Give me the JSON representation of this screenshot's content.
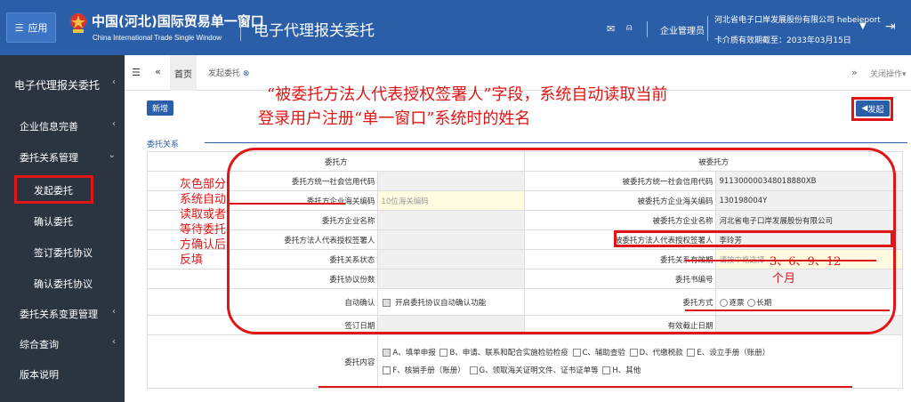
{
  "header": {
    "app_label": "应用",
    "logo_cn": "中国(河北)国际贸易单一窗口",
    "logo_en": "China International Trade Single Window",
    "system_name": "电子代理报关委托",
    "admin_label": "企业管理员",
    "company": "河北省电子口岸发展股份有限公司 hebeieport",
    "expiry": "卡介质有效期截至：2033年03月15日"
  },
  "sidebar": {
    "title": "电子代理报关委托",
    "items": [
      "企业信息完善",
      "委托关系管理",
      "发起委托",
      "确认委托",
      "签订委托协议",
      "确认委托协议",
      "委托关系变更管理",
      "综合查询",
      "版本说明"
    ]
  },
  "tabs": {
    "home": "首页",
    "active": "发起委托",
    "close_ops": "关闭操作"
  },
  "toolbar": {
    "add": "新增",
    "submit": "发起"
  },
  "section": {
    "title": "委托关系"
  },
  "form": {
    "left_head": "委托方",
    "right_head": "被委托方",
    "rows": [
      {
        "l": "委托方统一社会信用代码",
        "lv": "",
        "r": "被委托方统一社会信用代码",
        "rv": "911300000348018880XB"
      },
      {
        "l": "委托方企业海关编码",
        "lv": "10位海关编码",
        "r": "被委托方企业海关编码",
        "rv": "130198004Y"
      },
      {
        "l": "委托方企业名称",
        "lv": "",
        "r": "被委托方企业名称",
        "rv": "河北省电子口岸发展股份有限公司"
      },
      {
        "l": "委托方法人代表授权签署人",
        "lv": "",
        "r": "被委托方法人代表授权签署人",
        "rv": "李玲芳"
      },
      {
        "l": "委托关系状态",
        "lv": "",
        "r": "委托关系有效期",
        "rv": "请按中格选择"
      },
      {
        "l": "委托协议份数",
        "lv": "",
        "r": "委托书编号",
        "rv": ""
      }
    ],
    "auto_confirm_label": "自动确认",
    "auto_confirm_text": "开启委托协议自动确认功能",
    "mode_label": "委托方式",
    "mode_opts": [
      "逐票",
      "长期"
    ],
    "sign_date": "签订日期",
    "valid_end": "有效截止日期",
    "content_label": "委托内容",
    "content_line1": [
      "A、填单申报",
      "B、申请、联系和配合实施检验检疫",
      "C、辅助查验",
      "D、代缴税款",
      "E、设立手册（账册）"
    ],
    "content_line2": [
      "F、核销手册（账册）",
      "G、领取海关证明文件、证书证单等",
      "H、其他"
    ]
  },
  "annotations": {
    "top_line1": "“被委托方法人代表授权签署人”字段，系统自动读取当前",
    "top_line2": "登录用户注册“单一窗口”系统时的姓名",
    "side_note": "灰色部分系统自动读取或者等待委托方确认后反填",
    "period_note": "3、6、9、12",
    "period_unit": "个月"
  },
  "colors": {
    "header_bg": "#2a5ea8",
    "sidebar_bg": "#2b3441",
    "annotation": "#e01515"
  }
}
